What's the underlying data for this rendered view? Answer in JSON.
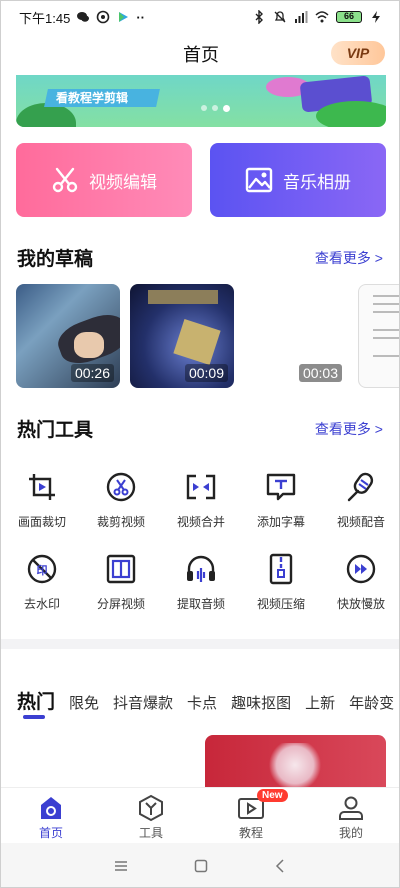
{
  "status_bar": {
    "time": "下午1:45",
    "battery": "66"
  },
  "header": {
    "title": "首页",
    "vip_label": "VIP"
  },
  "banner": {
    "text": "看教程学剪辑",
    "active_index": 2,
    "dot_count": 3
  },
  "quick_actions": {
    "video_edit": "视频编辑",
    "music_album": "音乐相册"
  },
  "drafts": {
    "title": "我的草稿",
    "more": "查看更多 >",
    "items": [
      {
        "duration": "00:26"
      },
      {
        "duration": "00:09"
      },
      {
        "duration": "00:03"
      }
    ]
  },
  "tools": {
    "title": "热门工具",
    "more": "查看更多 >",
    "items": [
      {
        "label": "画面裁切",
        "icon": "crop-icon"
      },
      {
        "label": "裁剪视频",
        "icon": "scissors-icon"
      },
      {
        "label": "视频合并",
        "icon": "merge-icon"
      },
      {
        "label": "添加字幕",
        "icon": "subtitle-icon"
      },
      {
        "label": "视频配音",
        "icon": "microphone-icon"
      },
      {
        "label": "去水印",
        "icon": "remove-watermark-icon"
      },
      {
        "label": "分屏视频",
        "icon": "split-screen-icon"
      },
      {
        "label": "提取音频",
        "icon": "headphones-icon"
      },
      {
        "label": "视频压缩",
        "icon": "compress-icon"
      },
      {
        "label": "快放慢放",
        "icon": "speed-icon"
      }
    ]
  },
  "categories": [
    "热门",
    "限免",
    "抖音爆款",
    "卡点",
    "趣味抠图",
    "上新",
    "年龄变"
  ],
  "bottom_nav": {
    "items": [
      {
        "label": "首页",
        "icon": "home-icon"
      },
      {
        "label": "工具",
        "icon": "tools-icon"
      },
      {
        "label": "教程",
        "icon": "tutorial-icon"
      },
      {
        "label": "我的",
        "icon": "profile-icon"
      }
    ],
    "badge": "New",
    "active_index": 0
  },
  "colors": {
    "accent": "#3b3fd1",
    "edit_button": "#ff6b9b",
    "music_button": "#5b53f2"
  }
}
